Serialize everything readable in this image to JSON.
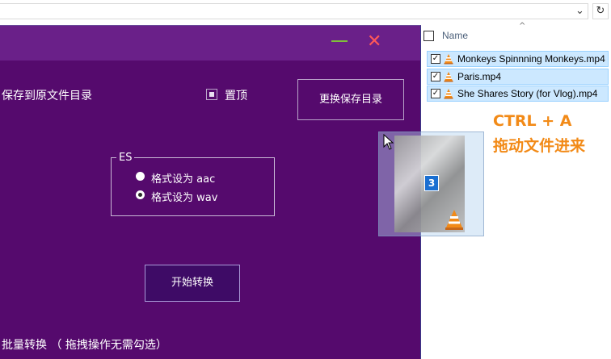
{
  "explorer": {
    "address_dropdown_icon": "chevron-down-icon",
    "refresh_icon": "refresh-icon",
    "sort_indicator": "^",
    "column_name": "Name",
    "files": [
      {
        "name": "Monkeys Spinnning Monkeys.mp4",
        "checked": true
      },
      {
        "name": "Paris.mp4",
        "checked": true
      },
      {
        "name": "She Shares Story (for Vlog).mp4",
        "checked": true
      }
    ]
  },
  "app": {
    "minimize_icon": "minimize-icon",
    "close_icon": "close-icon",
    "save_to_original_dir": "保存到原文件目录",
    "always_on_top": {
      "label": "置顶",
      "checked": true
    },
    "change_save_dir_button": "更换保存目录",
    "es_group": {
      "legend": "ES",
      "options": [
        {
          "label": "格式设为 aac",
          "selected": false
        },
        {
          "label": "格式设为 wav",
          "selected": true
        }
      ]
    },
    "start_button": "开始转换",
    "batch_label": "批量转换 （ 拖拽操作无需勾选）"
  },
  "drag": {
    "count": "3",
    "hint_line1": "CTRL + A",
    "hint_line2": "拖动文件进来"
  },
  "colors": {
    "app_bg": "#550a6d",
    "title_bar": "#6a2089",
    "selection": "#cce8ff",
    "hint": "#f28a17",
    "close": "#ff5858",
    "minimize": "#7fc03a"
  }
}
